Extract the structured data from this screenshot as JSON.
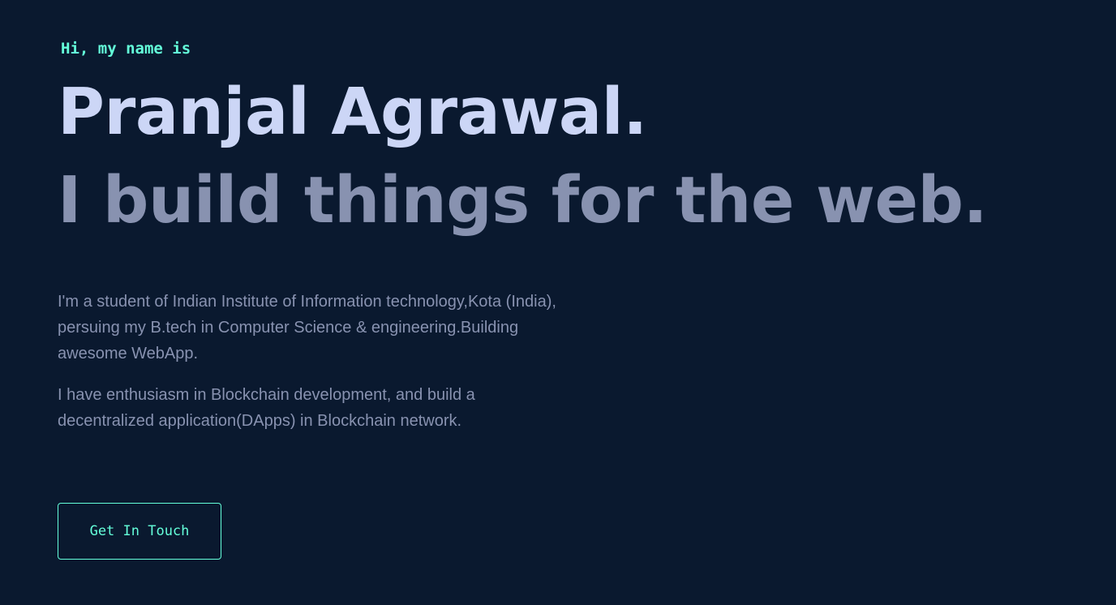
{
  "hero": {
    "greeting": "Hi, my name is",
    "name": "Pranjal Agrawal.",
    "tagline": "I build things for the web.",
    "bio": [
      "I'm a student of Indian Institute of Information technology,Kota (India), persuing my B.tech in Computer Science & engineering.Building awesome WebApp.",
      "I have enthusiasm in Blockchain development, and build a decentralized application(DApps) in Blockchain network."
    ],
    "cta_label": "Get In Touch"
  },
  "colors": {
    "background": "#0a192f",
    "accent": "#64ffda",
    "heading": "#ccd6f6",
    "muted": "#8892b0"
  }
}
